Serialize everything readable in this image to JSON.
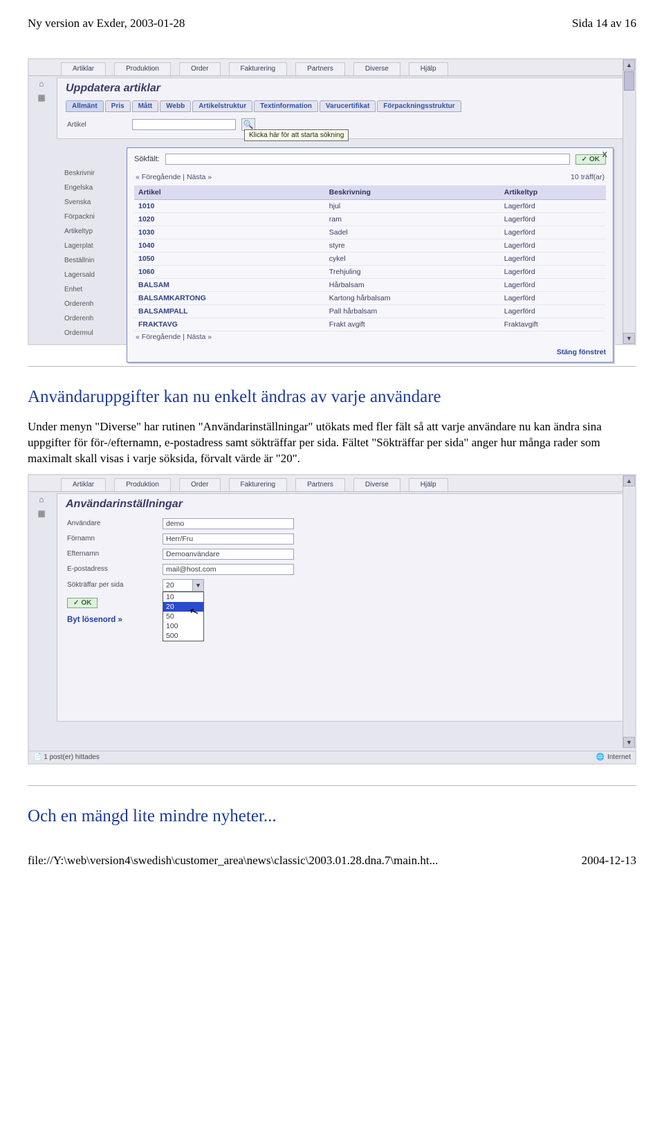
{
  "header": {
    "left": "Ny version av Exder, 2003-01-28",
    "right": "Sida 14 av 16"
  },
  "section1": {
    "title": "Användaruppgifter kan nu enkelt ändras av varje användare",
    "para": "Under menyn \"Diverse\" har rutinen \"Användarinställningar\" utökats med fler fält så att varje användare nu kan ändra sina uppgifter för för-/efternamn, e-postadress samt sökträffar per sida. Fältet \"Sökträffar per sida\" anger hur många rader som maximalt skall visas i varje söksida, förvalt värde är \"20\"."
  },
  "shot1": {
    "menu": [
      "Artiklar",
      "Produktion",
      "Order",
      "Fakturering",
      "Partners",
      "Diverse",
      "Hjälp"
    ],
    "paneTitle": "Uppdatera artiklar",
    "subtabs": [
      "Allmänt",
      "Pris",
      "Mått",
      "Webb",
      "Artikelstruktur",
      "Textinformation",
      "Varucertifikat",
      "Förpackningsstruktur"
    ],
    "fieldArtikel": "Artikel",
    "tooltip": "Klicka här för att starta sökning",
    "sideLabels": [
      "Beskrivnir",
      "Engelska",
      "Svenska",
      "Förpackni",
      "Artikeltyp",
      "Lagerplat",
      "Beställnin",
      "Lagersald",
      "Enhet",
      "Orderenh",
      "Orderenh",
      "Ordermul"
    ],
    "popup": {
      "sokfalt": "Sökfält:",
      "ok": "OK",
      "prevnext": "« Föregående | Nästa »",
      "hits": "10 träff(ar)",
      "cols": [
        "Artikel",
        "Beskrivning",
        "Artikeltyp"
      ],
      "rows": [
        [
          "1010",
          "hjul",
          "Lagerförd"
        ],
        [
          "1020",
          "ram",
          "Lagerförd"
        ],
        [
          "1030",
          "Sadel",
          "Lagerförd"
        ],
        [
          "1040",
          "styre",
          "Lagerförd"
        ],
        [
          "1050",
          "cykel",
          "Lagerförd"
        ],
        [
          "1060",
          "Trehjuling",
          "Lagerförd"
        ],
        [
          "BALSAM",
          "Hårbalsam",
          "Lagerförd"
        ],
        [
          "BALSAMKARTONG",
          "Kartong hårbalsam",
          "Lagerförd"
        ],
        [
          "BALSAMPALL",
          "Pall hårbalsam",
          "Lagerförd"
        ],
        [
          "FRAKTAVG",
          "Frakt avgift",
          "Fraktavgift"
        ]
      ],
      "close": "Stäng fönstret"
    }
  },
  "shot2": {
    "menu": [
      "Artiklar",
      "Produktion",
      "Order",
      "Fakturering",
      "Partners",
      "Diverse",
      "Hjälp"
    ],
    "paneTitle": "Användarinställningar",
    "fields": {
      "anvandare": {
        "label": "Användare",
        "value": "demo"
      },
      "fornamn": {
        "label": "Förnamn",
        "value": "Herr/Fru"
      },
      "efternamn": {
        "label": "Efternamn",
        "value": "Demoanvändare"
      },
      "epost": {
        "label": "E-postadress",
        "value": "mail@host.com"
      },
      "hits": {
        "label": "Sökträffar per sida",
        "value": "20"
      }
    },
    "dropdown": [
      "10",
      "20",
      "50",
      "100",
      "500"
    ],
    "ok": "OK",
    "bytlosen": "Byt lösenord »",
    "status": {
      "left": "1 post(er) hittades",
      "right": "Internet"
    }
  },
  "section2": {
    "title": "Och en mängd lite mindre nyheter..."
  },
  "footer": {
    "left": "file://Y:\\web\\version4\\swedish\\customer_area\\news\\classic\\2003.01.28.dna.7\\main.ht...",
    "right": "2004-12-13"
  }
}
